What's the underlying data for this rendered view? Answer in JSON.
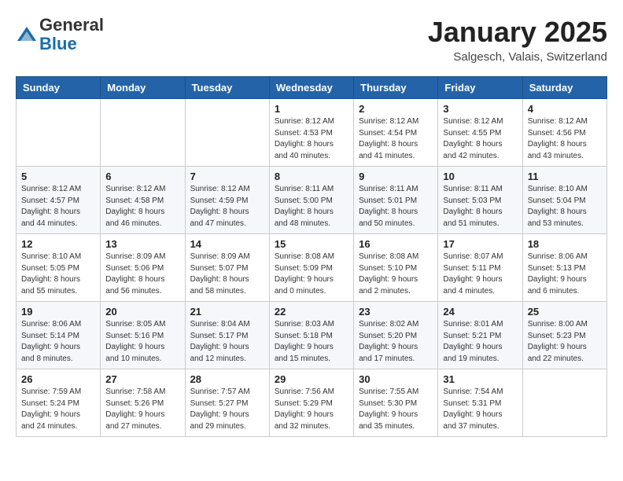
{
  "header": {
    "logo_line1": "General",
    "logo_line2": "Blue",
    "month_title": "January 2025",
    "location": "Salgesch, Valais, Switzerland"
  },
  "weekdays": [
    "Sunday",
    "Monday",
    "Tuesday",
    "Wednesday",
    "Thursday",
    "Friday",
    "Saturday"
  ],
  "weeks": [
    [
      {
        "day": "",
        "info": ""
      },
      {
        "day": "",
        "info": ""
      },
      {
        "day": "",
        "info": ""
      },
      {
        "day": "1",
        "info": "Sunrise: 8:12 AM\nSunset: 4:53 PM\nDaylight: 8 hours\nand 40 minutes."
      },
      {
        "day": "2",
        "info": "Sunrise: 8:12 AM\nSunset: 4:54 PM\nDaylight: 8 hours\nand 41 minutes."
      },
      {
        "day": "3",
        "info": "Sunrise: 8:12 AM\nSunset: 4:55 PM\nDaylight: 8 hours\nand 42 minutes."
      },
      {
        "day": "4",
        "info": "Sunrise: 8:12 AM\nSunset: 4:56 PM\nDaylight: 8 hours\nand 43 minutes."
      }
    ],
    [
      {
        "day": "5",
        "info": "Sunrise: 8:12 AM\nSunset: 4:57 PM\nDaylight: 8 hours\nand 44 minutes."
      },
      {
        "day": "6",
        "info": "Sunrise: 8:12 AM\nSunset: 4:58 PM\nDaylight: 8 hours\nand 46 minutes."
      },
      {
        "day": "7",
        "info": "Sunrise: 8:12 AM\nSunset: 4:59 PM\nDaylight: 8 hours\nand 47 minutes."
      },
      {
        "day": "8",
        "info": "Sunrise: 8:11 AM\nSunset: 5:00 PM\nDaylight: 8 hours\nand 48 minutes."
      },
      {
        "day": "9",
        "info": "Sunrise: 8:11 AM\nSunset: 5:01 PM\nDaylight: 8 hours\nand 50 minutes."
      },
      {
        "day": "10",
        "info": "Sunrise: 8:11 AM\nSunset: 5:03 PM\nDaylight: 8 hours\nand 51 minutes."
      },
      {
        "day": "11",
        "info": "Sunrise: 8:10 AM\nSunset: 5:04 PM\nDaylight: 8 hours\nand 53 minutes."
      }
    ],
    [
      {
        "day": "12",
        "info": "Sunrise: 8:10 AM\nSunset: 5:05 PM\nDaylight: 8 hours\nand 55 minutes."
      },
      {
        "day": "13",
        "info": "Sunrise: 8:09 AM\nSunset: 5:06 PM\nDaylight: 8 hours\nand 56 minutes."
      },
      {
        "day": "14",
        "info": "Sunrise: 8:09 AM\nSunset: 5:07 PM\nDaylight: 8 hours\nand 58 minutes."
      },
      {
        "day": "15",
        "info": "Sunrise: 8:08 AM\nSunset: 5:09 PM\nDaylight: 9 hours\nand 0 minutes."
      },
      {
        "day": "16",
        "info": "Sunrise: 8:08 AM\nSunset: 5:10 PM\nDaylight: 9 hours\nand 2 minutes."
      },
      {
        "day": "17",
        "info": "Sunrise: 8:07 AM\nSunset: 5:11 PM\nDaylight: 9 hours\nand 4 minutes."
      },
      {
        "day": "18",
        "info": "Sunrise: 8:06 AM\nSunset: 5:13 PM\nDaylight: 9 hours\nand 6 minutes."
      }
    ],
    [
      {
        "day": "19",
        "info": "Sunrise: 8:06 AM\nSunset: 5:14 PM\nDaylight: 9 hours\nand 8 minutes."
      },
      {
        "day": "20",
        "info": "Sunrise: 8:05 AM\nSunset: 5:16 PM\nDaylight: 9 hours\nand 10 minutes."
      },
      {
        "day": "21",
        "info": "Sunrise: 8:04 AM\nSunset: 5:17 PM\nDaylight: 9 hours\nand 12 minutes."
      },
      {
        "day": "22",
        "info": "Sunrise: 8:03 AM\nSunset: 5:18 PM\nDaylight: 9 hours\nand 15 minutes."
      },
      {
        "day": "23",
        "info": "Sunrise: 8:02 AM\nSunset: 5:20 PM\nDaylight: 9 hours\nand 17 minutes."
      },
      {
        "day": "24",
        "info": "Sunrise: 8:01 AM\nSunset: 5:21 PM\nDaylight: 9 hours\nand 19 minutes."
      },
      {
        "day": "25",
        "info": "Sunrise: 8:00 AM\nSunset: 5:23 PM\nDaylight: 9 hours\nand 22 minutes."
      }
    ],
    [
      {
        "day": "26",
        "info": "Sunrise: 7:59 AM\nSunset: 5:24 PM\nDaylight: 9 hours\nand 24 minutes."
      },
      {
        "day": "27",
        "info": "Sunrise: 7:58 AM\nSunset: 5:26 PM\nDaylight: 9 hours\nand 27 minutes."
      },
      {
        "day": "28",
        "info": "Sunrise: 7:57 AM\nSunset: 5:27 PM\nDaylight: 9 hours\nand 29 minutes."
      },
      {
        "day": "29",
        "info": "Sunrise: 7:56 AM\nSunset: 5:29 PM\nDaylight: 9 hours\nand 32 minutes."
      },
      {
        "day": "30",
        "info": "Sunrise: 7:55 AM\nSunset: 5:30 PM\nDaylight: 9 hours\nand 35 minutes."
      },
      {
        "day": "31",
        "info": "Sunrise: 7:54 AM\nSunset: 5:31 PM\nDaylight: 9 hours\nand 37 minutes."
      },
      {
        "day": "",
        "info": ""
      }
    ]
  ]
}
